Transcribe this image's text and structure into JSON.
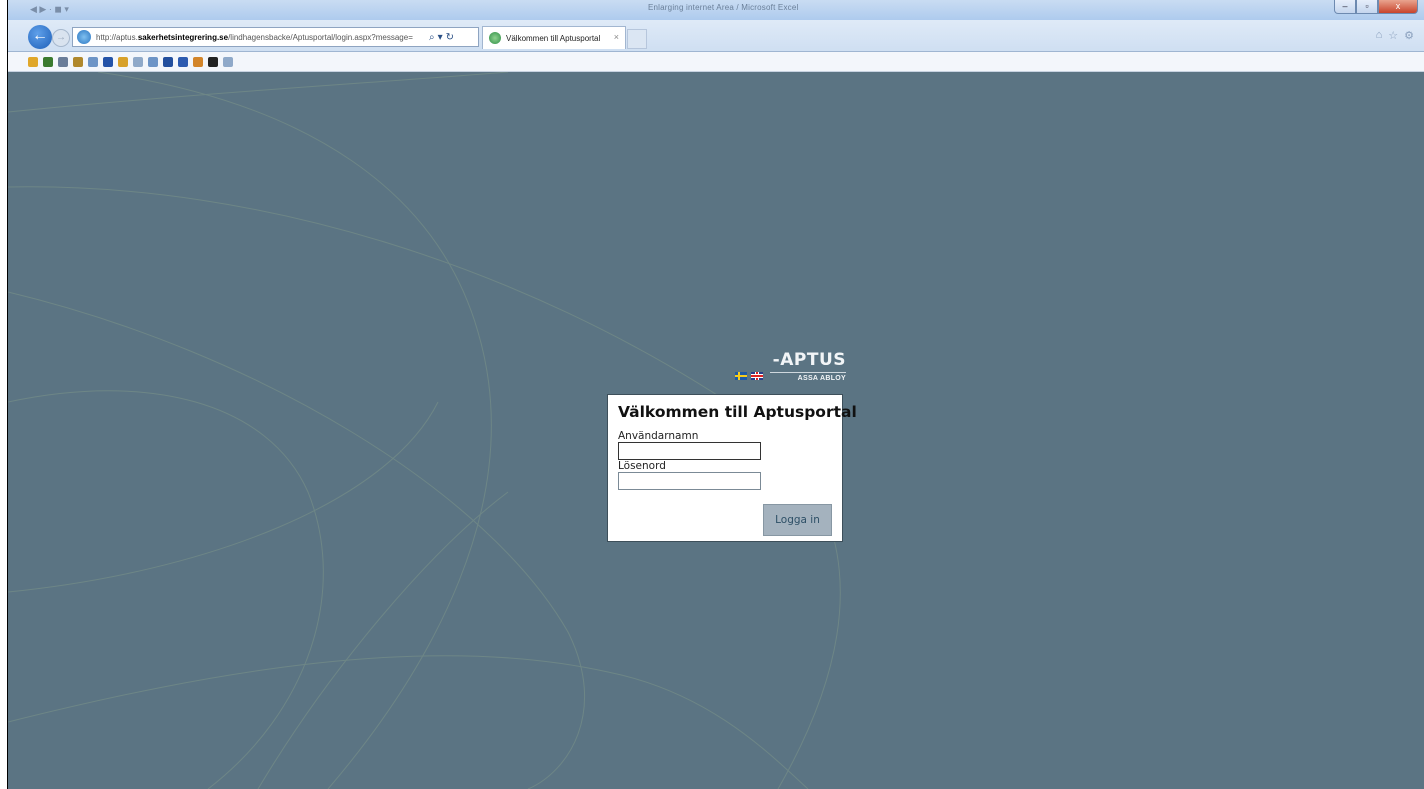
{
  "browser": {
    "window_title": "Enlarging internet Area / Microsoft Excel",
    "quick_access": "◀ ▶ · ◼ ▾",
    "address_url_prefix": "http://aptus.",
    "address_url_domain": "sakerhetsintegrering.se",
    "address_url_suffix": "/lindhagensbacke/Aptusportal/login.aspx?message=",
    "search_icon": "⌕",
    "dropdown_icon": "▾",
    "refresh_icon": "↻",
    "tab_label": "Välkommen till Aptusportal",
    "tab_close": "×",
    "back_icon": "←",
    "forward_icon": "→",
    "home_icon": "⌂",
    "favorites_icon": "☆",
    "tools_icon": "⚙",
    "minimize": "–",
    "maximize": "▫",
    "close": "x"
  },
  "favorites_colors": [
    "#e0a72a",
    "#3a7a2f",
    "#6a7d99",
    "#b0882c",
    "#6d94c6",
    "#2453a8",
    "#d8a12a",
    "#8fa9c9",
    "#6d94c6",
    "#234f9e",
    "#2d5bb0",
    "#d3852a",
    "#222222",
    "#8fa9c9"
  ],
  "logo": {
    "brand": "APTUS",
    "brand_mark": "-",
    "sub_brand": "ASSA ABLOY"
  },
  "login": {
    "title": "Välkommen till Aptusportal",
    "username_label": "Användarnamn",
    "username_value": "",
    "password_label": "Lösenord",
    "password_value": "",
    "submit_label": "Logga in"
  },
  "colors": {
    "page_background": "#5b7483",
    "button_background": "#a4b2be",
    "button_text": "#2d4f66"
  }
}
